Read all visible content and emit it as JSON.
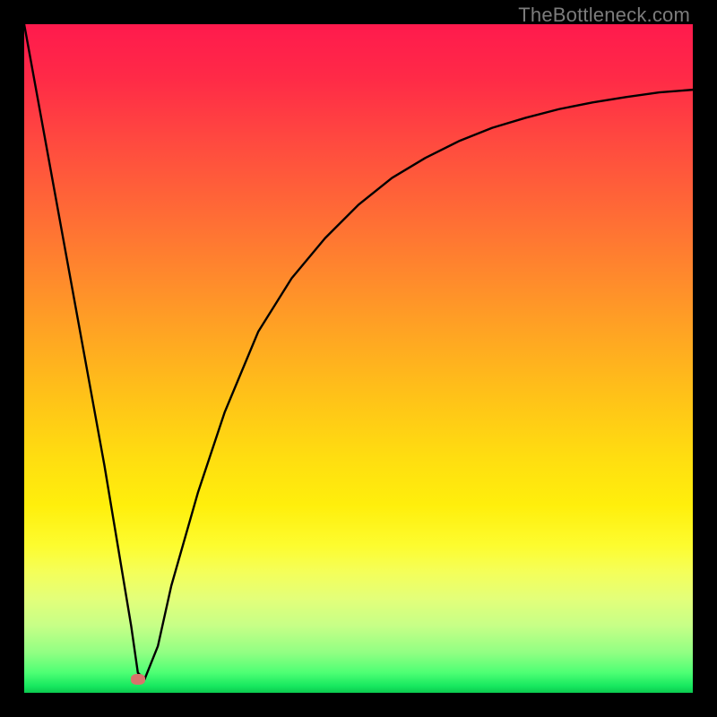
{
  "watermark": "TheBottleneck.com",
  "colors": {
    "background": "#000000",
    "curve": "#000000",
    "marker": "#d9736b"
  },
  "chart_data": {
    "type": "line",
    "title": "",
    "xlabel": "",
    "ylabel": "",
    "xlim": [
      0,
      100
    ],
    "ylim": [
      0,
      100
    ],
    "series": [
      {
        "name": "bottleneck-curve",
        "x": [
          0,
          2,
          4,
          6,
          8,
          10,
          12,
          14,
          16,
          17,
          18,
          20,
          22,
          26,
          30,
          35,
          40,
          45,
          50,
          55,
          60,
          65,
          70,
          75,
          80,
          85,
          90,
          95,
          100
        ],
        "values": [
          100,
          89,
          78,
          67,
          56,
          45,
          34,
          22,
          10,
          3,
          2,
          7,
          16,
          30,
          42,
          54,
          62,
          68,
          73,
          77,
          80,
          82.5,
          84.5,
          86,
          87.3,
          88.3,
          89.1,
          89.8,
          90.2
        ]
      }
    ],
    "marker": {
      "x": 17,
      "y": 2
    },
    "gradient": {
      "top_color": "#ff1a4d",
      "bottom_color": "#0cc94f"
    }
  }
}
